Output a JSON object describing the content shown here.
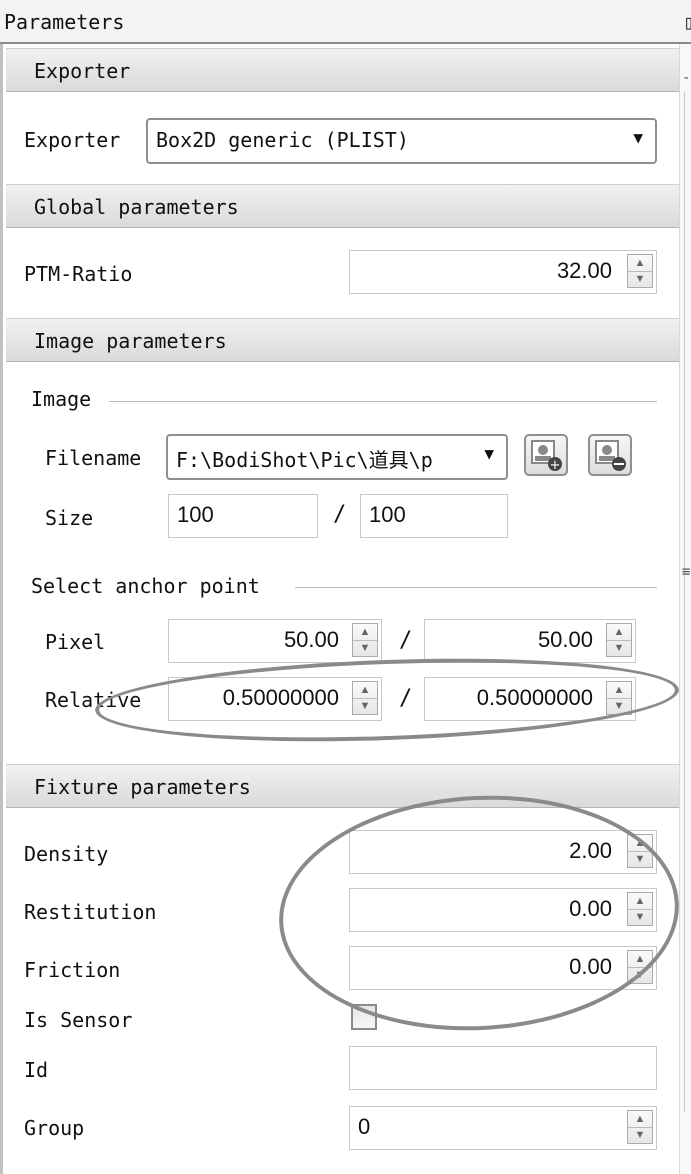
{
  "window": {
    "title": "Parameters"
  },
  "sections": {
    "exporter": "Exporter",
    "global": "Global parameters",
    "image": "Image parameters",
    "fixture": "Fixture parameters"
  },
  "exporter": {
    "label": "Exporter",
    "value": "Box2D generic (PLIST)"
  },
  "global": {
    "ptm_label": "PTM-Ratio",
    "ptm_value": "32.00"
  },
  "image": {
    "group_title": "Image",
    "filename_label": "Filename",
    "filename_value": "F:\\BodiShot\\Pic\\道具\\p",
    "size_label": "Size",
    "width": "100",
    "height": "100",
    "slash": "/"
  },
  "anchor": {
    "group_title": "Select anchor point",
    "pixel_label": "Pixel",
    "pixel_x": "50.00",
    "pixel_y": "50.00",
    "relative_label": "Relative",
    "relative_x": "0.50000000",
    "relative_y": "0.50000000",
    "slash": "/"
  },
  "fixture": {
    "density_label": "Density",
    "density_value": "2.00",
    "restitution_label": "Restitution",
    "restitution_value": "0.00",
    "friction_label": "Friction",
    "friction_value": "0.00",
    "sensor_label": "Is Sensor",
    "sensor_checked": false,
    "id_label": "Id",
    "id_value": "",
    "group_label": "Group",
    "group_value": "0"
  },
  "icons": {
    "add_image": "image-add-icon",
    "remove_image": "image-remove-icon",
    "dropdown": "chevron-down-icon",
    "spin_up": "arrow-up-icon",
    "spin_down": "arrow-down-icon"
  }
}
